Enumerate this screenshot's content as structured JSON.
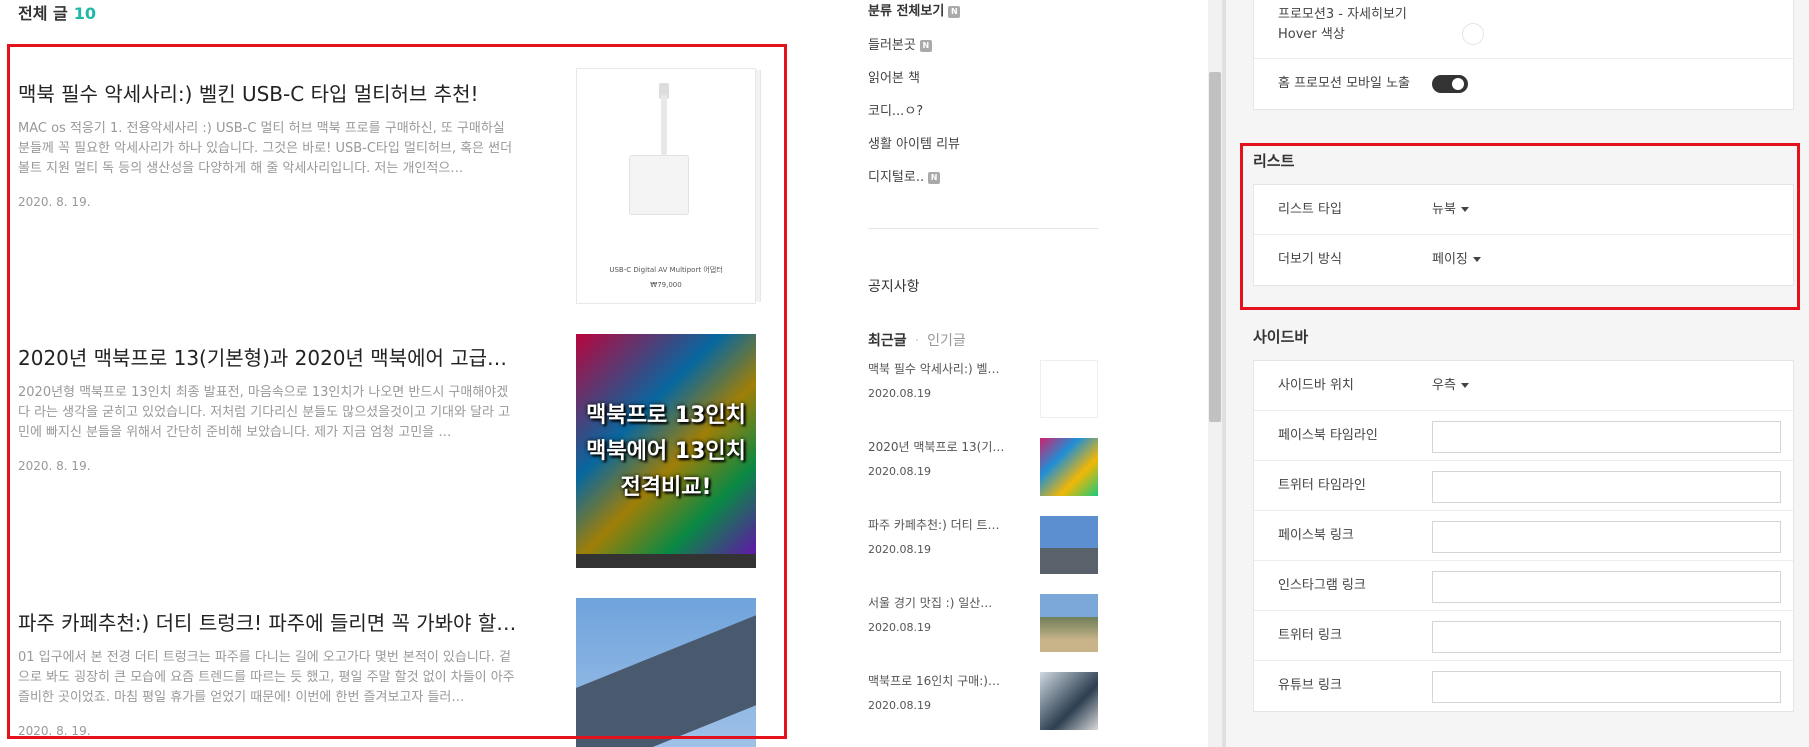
{
  "preview": {
    "total_label": "전체 글",
    "total_count": "10",
    "posts": [
      {
        "title": "맥북 필수 악세사리:) 벨킨 USB-C 타입 멀티허브 추천!",
        "excerpt": "MAC os 적응기 1. 전용악세사리 :) USB-C 멀티 허브 맥북 프로를 구매하신, 또 구매하실 분들께 꼭 필요한 악세사리가 하나 있습니다. 그것은 바로!  USB-C타입 멀티허브, 혹은 썬더볼트 지원 멀티 독 등의 생산성을 다양하게 해 줄 악세사리입니다.  저는 개인적으…",
        "date": "2020. 8. 19.",
        "thumb_caption": "USB-C Digital AV Multiport 어댑터",
        "thumb_price": "₩79,000"
      },
      {
        "title": "2020년 맥북프로 13(기본형)과 2020년 맥북에어 고급형 ...",
        "excerpt": "2020년형 맥북프로 13인치 최종 발표전, 마음속으로 13인치가 나오면 반드시 구매해야겠다 라는 생각을 굳히고 있었습니다.  저처럼 기다리신 분들도 많으셨을것이고 기대와 달라 고민에 빠지신 분들을 위해서 간단히 준비해 보았습니다. 제가 지금 엄청 고민을 …",
        "date": "2020. 8. 19.",
        "thumb_text": "맥북프로 13인치\n맥북에어 13인치\n전격비교!"
      },
      {
        "title": "파주 카페추천:) 더티 트렁크! 파주에 들리면 꼭 가봐야 할 ...",
        "excerpt": "01 입구에서 본 전경 더티 트렁크는 파주를 다니는 길에 오고가다 몇번 본적이 있습니다. 겉으로 봐도 굉장히 큰 모습에 요즘 트렌드를 따르는 듯 했고, 평일 주말 할것 없이 차들이 아주 즐비한 곳이었죠. 마침 평일 휴가를 얻었기 때문에! 이번에 한번 즐겨보고자 들러…",
        "date": "2020. 8. 19."
      }
    ],
    "categories": {
      "all": "분류 전체보기",
      "items": [
        "들러본곳",
        "읽어본 책",
        "코디...ㅇ?",
        "생활 아이템 리뷰",
        "디지털로.."
      ],
      "new_badge": "N"
    },
    "notice_label": "공지사항",
    "tabs": {
      "recent": "최근글",
      "popular": "인기글"
    },
    "recent_posts": [
      {
        "title": "맥북 필수 악세사리:) 벨…",
        "date": "2020.08.19"
      },
      {
        "title": "2020년 맥북프로 13(기본…",
        "date": "2020.08.19"
      },
      {
        "title": "파주 카페추천:) 더티 트…",
        "date": "2020.08.19"
      },
      {
        "title": "서울 경기 맛집 :) 일산…",
        "date": "2020.08.19"
      },
      {
        "title": "맥북프로 16인치 구매:)…",
        "date": "2020.08.19"
      }
    ]
  },
  "settings": {
    "promo_color_label": "프로모션3 - 자세히보기 Hover 색상",
    "promo_mobile_label": "홈 프로모션 모바일 노출",
    "promo_mobile_on": true,
    "list_section": {
      "title": "리스트",
      "rows": [
        {
          "label": "리스트 타입",
          "value": "뉴북"
        },
        {
          "label": "더보기 방식",
          "value": "페이징"
        }
      ]
    },
    "sidebar_section": {
      "title": "사이드바",
      "position_label": "사이드바 위치",
      "position_value": "우측",
      "fields": [
        {
          "label": "페이스북 타임라인",
          "value": ""
        },
        {
          "label": "트위터 타임라인",
          "value": ""
        },
        {
          "label": "페이스북 링크",
          "value": ""
        },
        {
          "label": "인스타그램 링크",
          "value": ""
        },
        {
          "label": "트위터 링크",
          "value": ""
        },
        {
          "label": "유튜브 링크",
          "value": ""
        }
      ]
    }
  },
  "colors": {
    "accent": "#1fb8a6",
    "highlight_border": "#e3121c",
    "toggle_on": "#333333"
  }
}
